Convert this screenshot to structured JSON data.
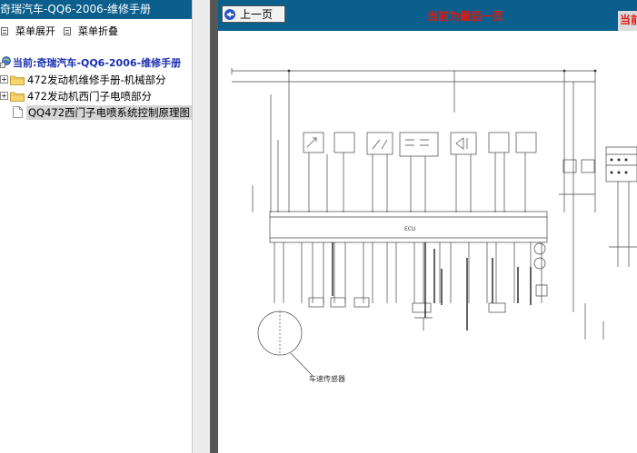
{
  "left_panel": {
    "title": "奇瑞汽车-QQ6-2006-维修手册",
    "menu": {
      "expand_label": "菜单展开",
      "collapse_label": "菜单折叠"
    },
    "tree": {
      "root_label": "当前:奇瑞汽车-QQ6-2006-维修手册",
      "items": [
        {
          "label": "472发动机维修手册-机械部分",
          "expander": "+",
          "icon": "folder-icon"
        },
        {
          "label": "472发动机西门子电喷部分",
          "expander": "+",
          "icon": "folder-icon"
        },
        {
          "label": "QQ472西门子电喷系统控制原理图",
          "icon": "page-icon",
          "selected": true
        }
      ]
    }
  },
  "right_panel": {
    "prev_button_label": "上一页",
    "last_page_message": "当前为最后一页",
    "last_page_message_clipped": "当前",
    "diagram": {
      "ecu_label": "ECU",
      "sensor_label": "车速传感器"
    }
  },
  "colors": {
    "header_blue": "#0a5f8c",
    "message_red": "#e3170d",
    "root_label_blue": "#1a2fb0"
  }
}
